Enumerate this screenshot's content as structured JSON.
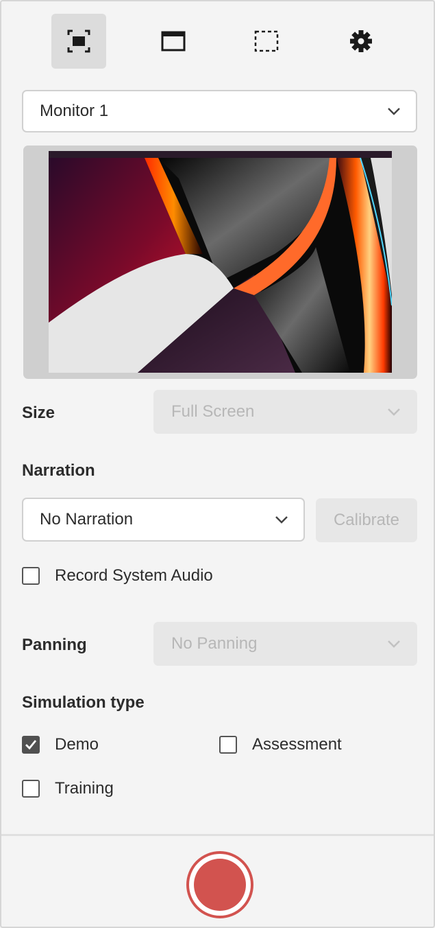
{
  "toolbar": {
    "items": [
      {
        "name": "full-screen-mode",
        "active": true
      },
      {
        "name": "window-mode",
        "active": false
      },
      {
        "name": "custom-area-mode",
        "active": false
      },
      {
        "name": "settings",
        "active": false
      }
    ]
  },
  "monitor_select": {
    "value": "Monitor 1"
  },
  "size": {
    "label": "Size",
    "value": "Full Screen"
  },
  "narration": {
    "label": "Narration",
    "value": "No Narration",
    "calibrate_label": "Calibrate"
  },
  "record_system_audio": {
    "label": "Record System Audio",
    "checked": false
  },
  "panning": {
    "label": "Panning",
    "value": "No Panning"
  },
  "simulation": {
    "label": "Simulation type",
    "options": [
      {
        "label": "Demo",
        "checked": true
      },
      {
        "label": "Assessment",
        "checked": false
      },
      {
        "label": "Training",
        "checked": false
      }
    ]
  },
  "colors": {
    "record": "#d2534f",
    "panel_bg": "#f4f4f4",
    "active_tool_bg": "#dcdcdc"
  }
}
